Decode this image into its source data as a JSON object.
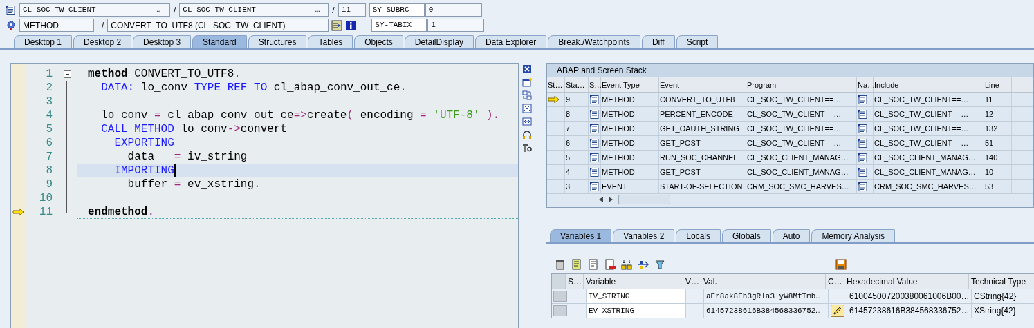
{
  "header": {
    "row1": {
      "include": "CL_SOC_TW_CLIENT=============…",
      "sep1": "/",
      "program": "CL_SOC_TW_CLIENT=============…",
      "sep2": "/",
      "line": "11",
      "sysfield": "SY-SUBRC",
      "sysvalue": "0"
    },
    "row2": {
      "event_type": "METHOD",
      "sep": "/",
      "event": "CONVERT_TO_UTF8 (CL_SOC_TW_CLIENT)",
      "sysfield": "SY-TABIX",
      "sysvalue": "1"
    }
  },
  "desktop_tabs": [
    {
      "label": "Desktop 1",
      "selected": false
    },
    {
      "label": "Desktop 2",
      "selected": false
    },
    {
      "label": "Desktop 3",
      "selected": false
    },
    {
      "label": "Standard",
      "selected": true
    },
    {
      "label": "Structures",
      "selected": false
    },
    {
      "label": "Tables",
      "selected": false
    },
    {
      "label": "Objects",
      "selected": false
    },
    {
      "label": "DetailDisplay",
      "selected": false
    },
    {
      "label": "Data Explorer",
      "selected": false
    },
    {
      "label": "Break./Watchpoints",
      "selected": false
    },
    {
      "label": "Diff",
      "selected": false
    },
    {
      "label": "Script",
      "selected": false
    }
  ],
  "code": [
    {
      "number": "1",
      "foldable": true,
      "highlighted": false,
      "current": false,
      "segments": [
        {
          "kind": "bold",
          "text": "method"
        },
        {
          "kind": "plain",
          "text": " CONVERT_TO_UTF8"
        },
        {
          "kind": "op",
          "text": "."
        }
      ]
    },
    {
      "number": "2",
      "foldable": false,
      "highlighted": false,
      "current": false,
      "segments": [
        {
          "kind": "keyword",
          "text": "  DATA:"
        },
        {
          "kind": "plain",
          "text": " lo_conv "
        },
        {
          "kind": "keyword",
          "text": "TYPE REF TO"
        },
        {
          "kind": "plain",
          "text": " cl_abap_conv_out_ce"
        },
        {
          "kind": "op",
          "text": "."
        }
      ]
    },
    {
      "number": "3",
      "foldable": false,
      "highlighted": false,
      "current": false
    },
    {
      "number": "4",
      "foldable": false,
      "highlighted": false,
      "current": false,
      "segments": [
        {
          "kind": "plain",
          "text": "  lo_conv "
        },
        {
          "kind": "op",
          "text": "="
        },
        {
          "kind": "plain",
          "text": " cl_abap_conv_out_ce"
        },
        {
          "kind": "op",
          "text": "=>"
        },
        {
          "kind": "plain",
          "text": "create"
        },
        {
          "kind": "op",
          "text": "("
        },
        {
          "kind": "plain",
          "text": " encoding "
        },
        {
          "kind": "op",
          "text": "= "
        },
        {
          "kind": "string",
          "text": "'UTF-8' "
        },
        {
          "kind": "op",
          "text": ")."
        }
      ]
    },
    {
      "number": "5",
      "foldable": false,
      "highlighted": false,
      "current": false,
      "segments": [
        {
          "kind": "keyword",
          "text": "  CALL METHOD"
        },
        {
          "kind": "plain",
          "text": " lo_conv"
        },
        {
          "kind": "op",
          "text": "->"
        },
        {
          "kind": "plain",
          "text": "convert"
        }
      ]
    },
    {
      "number": "6",
      "foldable": false,
      "highlighted": false,
      "current": false,
      "segments": [
        {
          "kind": "keyword",
          "text": "    EXPORTING"
        }
      ]
    },
    {
      "number": "7",
      "foldable": false,
      "highlighted": false,
      "current": false,
      "segments": [
        {
          "kind": "plain",
          "text": "      data   "
        },
        {
          "kind": "op",
          "text": "="
        },
        {
          "kind": "plain",
          "text": " iv_string"
        }
      ]
    },
    {
      "number": "8",
      "foldable": false,
      "highlighted": true,
      "current": false,
      "segments": [
        {
          "kind": "keyword",
          "text": "    IMPORTING"
        }
      ]
    },
    {
      "number": "9",
      "foldable": false,
      "highlighted": false,
      "current": false,
      "segments": [
        {
          "kind": "plain",
          "text": "      buffer "
        },
        {
          "kind": "op",
          "text": "="
        },
        {
          "kind": "plain",
          "text": " ev_xstring"
        },
        {
          "kind": "op",
          "text": "."
        }
      ]
    },
    {
      "number": "10",
      "foldable": false,
      "highlighted": false,
      "current": false
    },
    {
      "number": "11",
      "foldable": false,
      "highlighted": false,
      "current": true,
      "segments": [
        {
          "kind": "bold",
          "text": "endmethod"
        },
        {
          "kind": "op",
          "text": "."
        }
      ]
    }
  ],
  "stack": {
    "title": "ABAP and Screen Stack",
    "columns": [
      "St…",
      "Sta…",
      "S…",
      "Event Type",
      "Event",
      "Program",
      "Na…",
      "Include",
      "Line"
    ],
    "rows": [
      {
        "current": true,
        "level": "9",
        "event_type": "METHOD",
        "event": "CONVERT_TO_UTF8",
        "program": "CL_SOC_TW_CLIENT==…",
        "include": "CL_SOC_TW_CLIENT==…",
        "line": "11"
      },
      {
        "current": false,
        "level": "8",
        "event_type": "METHOD",
        "event": "PERCENT_ENCODE",
        "program": "CL_SOC_TW_CLIENT==…",
        "include": "CL_SOC_TW_CLIENT==…",
        "line": "12"
      },
      {
        "current": false,
        "level": "7",
        "event_type": "METHOD",
        "event": "GET_OAUTH_STRING",
        "program": "CL_SOC_TW_CLIENT==…",
        "include": "CL_SOC_TW_CLIENT==…",
        "line": "132"
      },
      {
        "current": false,
        "level": "6",
        "event_type": "METHOD",
        "event": "GET_POST",
        "program": "CL_SOC_TW_CLIENT==…",
        "include": "CL_SOC_TW_CLIENT==…",
        "line": "51"
      },
      {
        "current": false,
        "level": "5",
        "event_type": "METHOD",
        "event": "RUN_SOC_CHANNEL",
        "program": "CL_SOC_CLIENT_MANAG…",
        "include": "CL_SOC_CLIENT_MANAG…",
        "line": "140"
      },
      {
        "current": false,
        "level": "4",
        "event_type": "METHOD",
        "event": "GET_POST",
        "program": "CL_SOC_CLIENT_MANAG…",
        "include": "CL_SOC_CLIENT_MANAG…",
        "line": "10"
      },
      {
        "current": false,
        "level": "3",
        "event_type": "EVENT",
        "event": "START-OF-SELECTION",
        "program": "CRM_SOC_SMC_HARVES…",
        "include": "CRM_SOC_SMC_HARVES…",
        "line": "53"
      }
    ]
  },
  "variable_tabs": [
    {
      "label": "Variables 1",
      "selected": true
    },
    {
      "label": "Variables 2",
      "selected": false
    },
    {
      "label": "Locals",
      "selected": false
    },
    {
      "label": "Globals",
      "selected": false
    },
    {
      "label": "Auto",
      "selected": false
    },
    {
      "label": "Memory Analysis",
      "selected": false
    }
  ],
  "variables": {
    "columns": [
      "S…",
      "Variable",
      "V…",
      "Val.",
      "C…",
      "Hexadecimal Value",
      "Technical Type"
    ],
    "rows": [
      {
        "variable": "IV_STRING",
        "value": "aEr8ak8Eh3gRla3lyW8MfTmb…",
        "edit_button": false,
        "hex": "610045007200380061006B00…",
        "type": "CString{42}"
      },
      {
        "variable": "EV_XSTRING",
        "value": "61457238616B384568336752…",
        "edit_button": true,
        "hex": "61457238616B384568336752…",
        "type": "XString{42}"
      }
    ]
  }
}
